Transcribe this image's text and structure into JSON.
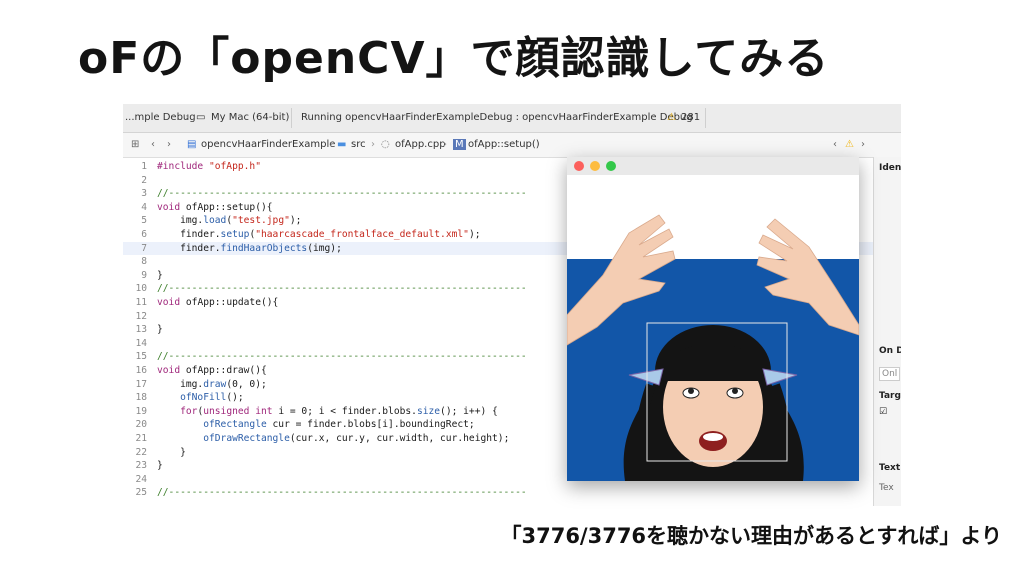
{
  "slide": {
    "title": "oFの「openCV」で顔認識してみる",
    "caption": "「3776/3776を聴かない理由があるとすれば」より"
  },
  "xcode": {
    "toolbar": {
      "scheme": "...mple Debug",
      "destination": "My Mac (64-bit)",
      "status": "Running opencvHaarFinderExampleDebug : opencvHaarFinderExample Debug",
      "warning_count": "281"
    },
    "jumpbar": {
      "project": "opencvHaarFinderExample",
      "folder": "src",
      "file": "ofApp.cpp",
      "symbol": "ofApp::setup()"
    },
    "inspector": {
      "identity": "Ident",
      "on_demand": "On D",
      "on_demand_field": "Onl",
      "target": "Targe",
      "text": "Text",
      "text_field": "Tex"
    },
    "code_lines": [
      {
        "n": "1",
        "segs": [
          {
            "t": "#include ",
            "c": "kw"
          },
          {
            "t": "\"ofApp.h\"",
            "c": "str"
          }
        ]
      },
      {
        "n": "2",
        "segs": []
      },
      {
        "n": "3",
        "segs": [
          {
            "t": "//--------------------------------------------------------------",
            "c": "cm"
          }
        ]
      },
      {
        "n": "4",
        "segs": [
          {
            "t": "void ",
            "c": "kw"
          },
          {
            "t": "ofApp::setup(){",
            "c": ""
          }
        ]
      },
      {
        "n": "5",
        "segs": [
          {
            "t": "    img.",
            "c": ""
          },
          {
            "t": "load",
            "c": "fn"
          },
          {
            "t": "(",
            "c": ""
          },
          {
            "t": "\"test.jpg\"",
            "c": "str"
          },
          {
            "t": ");",
            "c": ""
          }
        ]
      },
      {
        "n": "6",
        "segs": [
          {
            "t": "    finder.",
            "c": ""
          },
          {
            "t": "setup",
            "c": "fn"
          },
          {
            "t": "(",
            "c": ""
          },
          {
            "t": "\"haarcascade_frontalface_default.xml\"",
            "c": "str"
          },
          {
            "t": ");",
            "c": ""
          }
        ]
      },
      {
        "n": "7",
        "hl": true,
        "segs": [
          {
            "t": "    finder.",
            "c": ""
          },
          {
            "t": "findHaarObjects",
            "c": "fn"
          },
          {
            "t": "(img);",
            "c": ""
          }
        ]
      },
      {
        "n": "8",
        "segs": []
      },
      {
        "n": "9",
        "segs": [
          {
            "t": "}",
            "c": ""
          }
        ]
      },
      {
        "n": "10",
        "segs": [
          {
            "t": "//--------------------------------------------------------------",
            "c": "cm"
          }
        ]
      },
      {
        "n": "11",
        "segs": [
          {
            "t": "void ",
            "c": "kw"
          },
          {
            "t": "ofApp::update(){",
            "c": ""
          }
        ]
      },
      {
        "n": "12",
        "segs": []
      },
      {
        "n": "13",
        "segs": [
          {
            "t": "}",
            "c": ""
          }
        ]
      },
      {
        "n": "14",
        "segs": []
      },
      {
        "n": "15",
        "segs": [
          {
            "t": "//--------------------------------------------------------------",
            "c": "cm"
          }
        ]
      },
      {
        "n": "16",
        "segs": [
          {
            "t": "void ",
            "c": "kw"
          },
          {
            "t": "ofApp::draw(){",
            "c": ""
          }
        ]
      },
      {
        "n": "17",
        "segs": [
          {
            "t": "    img.",
            "c": ""
          },
          {
            "t": "draw",
            "c": "fn"
          },
          {
            "t": "(0, 0);",
            "c": ""
          }
        ]
      },
      {
        "n": "18",
        "segs": [
          {
            "t": "    ",
            "c": ""
          },
          {
            "t": "ofNoFill",
            "c": "fn"
          },
          {
            "t": "();",
            "c": ""
          }
        ]
      },
      {
        "n": "19",
        "segs": [
          {
            "t": "    for",
            "c": "kw"
          },
          {
            "t": "(",
            "c": ""
          },
          {
            "t": "unsigned int ",
            "c": "kw"
          },
          {
            "t": "i = 0; i < finder.blobs.",
            "c": ""
          },
          {
            "t": "size",
            "c": "fn"
          },
          {
            "t": "(); i++) {",
            "c": ""
          }
        ]
      },
      {
        "n": "20",
        "segs": [
          {
            "t": "        ",
            "c": ""
          },
          {
            "t": "ofRectangle ",
            "c": "fn"
          },
          {
            "t": "cur = finder.blobs[i].boundingRect;",
            "c": ""
          }
        ]
      },
      {
        "n": "21",
        "segs": [
          {
            "t": "        ",
            "c": ""
          },
          {
            "t": "ofDrawRectangle",
            "c": "fn"
          },
          {
            "t": "(cur.x, cur.y, cur.width, cur.height);",
            "c": ""
          }
        ]
      },
      {
        "n": "22",
        "segs": [
          {
            "t": "    }",
            "c": ""
          }
        ]
      },
      {
        "n": "23",
        "segs": [
          {
            "t": "}",
            "c": ""
          }
        ]
      },
      {
        "n": "24",
        "segs": []
      },
      {
        "n": "25",
        "segs": [
          {
            "t": "//--------------------------------------------------------------",
            "c": "cm"
          }
        ]
      }
    ]
  },
  "app_window": {
    "traffic_lights": [
      "#fc605c",
      "#fdbc40",
      "#34c84a"
    ],
    "photo_colors": {
      "wall": "#ffffff",
      "backdrop": "#1256a8",
      "skin": "#f4cdb3",
      "hair": "#141414",
      "face_box": "#e8e8e8"
    }
  },
  "colors": {
    "highlight_line": "#ecf1fb",
    "warning": "#f2b81a"
  }
}
